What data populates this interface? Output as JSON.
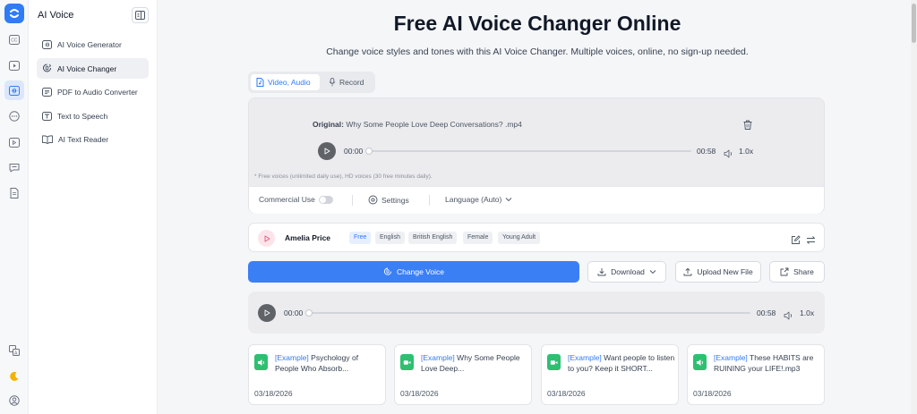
{
  "app": {
    "brand_color": "#2f7cf6"
  },
  "rail": {
    "items": [
      "captions-icon",
      "video-icon",
      "ai-voice-icon",
      "more-icon",
      "video-edit-icon",
      "chat-icon",
      "document-icon"
    ],
    "bottom": [
      "translate-icon",
      "theme-icon",
      "user-icon"
    ]
  },
  "sidebar": {
    "title": "AI Voice",
    "items": [
      {
        "label": "AI Voice Generator",
        "icon": "waveform-icon"
      },
      {
        "label": "AI Voice Changer",
        "icon": "voice-change-icon",
        "active": true
      },
      {
        "label": "PDF to Audio Converter",
        "icon": "pdf-icon"
      },
      {
        "label": "Text to Speech",
        "icon": "text-icon"
      },
      {
        "label": "AI Text Reader",
        "icon": "book-icon"
      }
    ]
  },
  "header": {
    "title": "Free AI Voice Changer Online",
    "subtitle": "Change voice styles and tones with this AI Voice Changer. Multiple voices, online, no sign-up needed."
  },
  "tabs": [
    {
      "label": "Video, Audio",
      "active": true
    },
    {
      "label": "Record",
      "active": false
    }
  ],
  "source": {
    "original_label": "Original:",
    "file_name": "Why Some People Love Deep Conversations? .mp4",
    "current_time": "00:00",
    "duration": "00:58",
    "speed": "1.0x",
    "progress": 0,
    "note": "* Free voices (unlimited daily use), HD voices (30 free minutes daily).",
    "commercial_use_label": "Commercial Use",
    "commercial_use_on": false,
    "settings_label": "Settings",
    "language_label": "Language (Auto)"
  },
  "voice": {
    "name": "Amelia Price",
    "tags": [
      "Free",
      "English",
      "British English",
      "Female",
      "Young Adult"
    ]
  },
  "actions": {
    "change_voice": "Change Voice",
    "download": "Download",
    "upload": "Upload New File",
    "share": "Share"
  },
  "result": {
    "current_time": "00:00",
    "duration": "00:58",
    "speed": "1.0x",
    "progress": 0
  },
  "examples": [
    {
      "tag": "[Example]",
      "title": "Psychology of People Who Absorb...",
      "date": "03/18/2026",
      "kind": "audio"
    },
    {
      "tag": "[Example]",
      "title": "Why Some People Love Deep...",
      "date": "03/18/2026",
      "kind": "video"
    },
    {
      "tag": "[Example]",
      "title": "Want people to listen to you?  Keep it SHORT...",
      "date": "03/18/2026",
      "kind": "video"
    },
    {
      "tag": "[Example]",
      "title": "These HABITS are RUINING your LIFE!.mp3",
      "date": "03/18/2026",
      "kind": "audio"
    }
  ]
}
